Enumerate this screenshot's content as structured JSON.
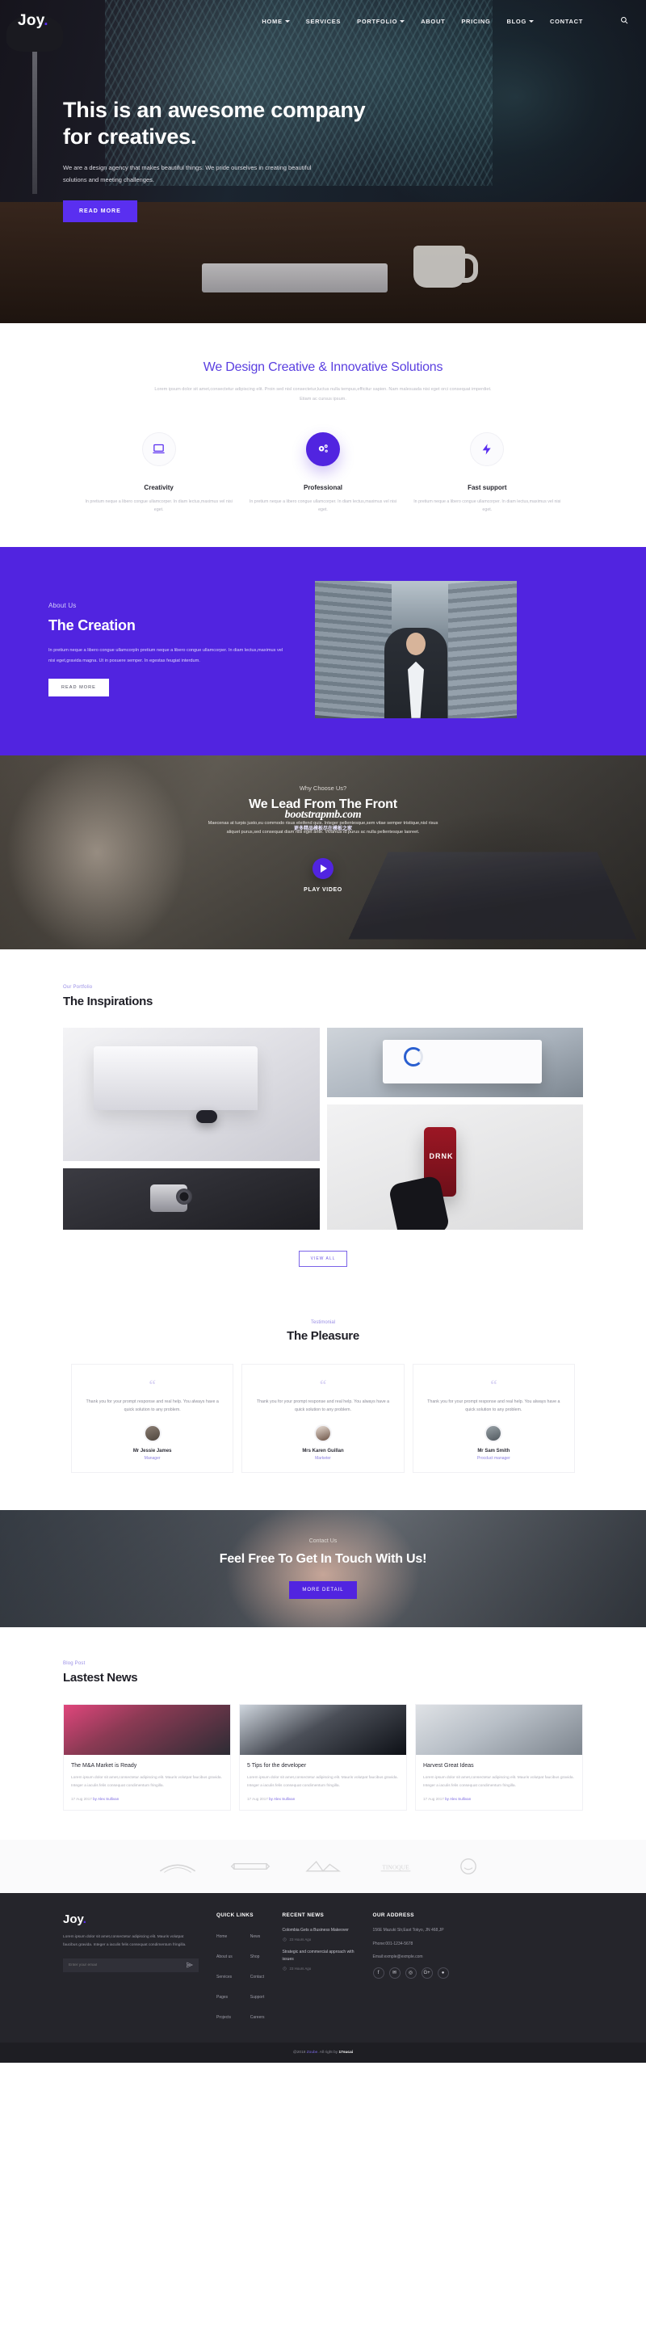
{
  "brand": {
    "name": "Joy",
    "dot": "."
  },
  "nav": {
    "items": [
      {
        "label": "HOME",
        "caret": true
      },
      {
        "label": "SERVICES",
        "caret": false
      },
      {
        "label": "PORTFOLIO",
        "caret": true
      },
      {
        "label": "ABOUT",
        "caret": false
      },
      {
        "label": "PRICING",
        "caret": false
      },
      {
        "label": "BLOG",
        "caret": true
      },
      {
        "label": "CONTACT",
        "caret": false
      }
    ],
    "search_icon": "search-icon"
  },
  "hero": {
    "title_line1": "This is an awesome company",
    "title_line2": "for creatives.",
    "subtitle": "We are a design agency that makes beautiful things. We pride ourselves in creating beautiful solutions and meeting challenges.",
    "cta": "READ MORE"
  },
  "services": {
    "title": "We Design Creative & Innovative Solutions",
    "lead": "Lorem ipsum dolor sit amet,consectetur adipiscing elit. Proin sed nisl consectetur,luctus nulla tempus,efficitur sapien. Nam malesuada nisi eget orci consequat imperdiet. Etiam ac cursus ipsum.",
    "features": [
      {
        "icon": "laptop-icon",
        "title": "Creativity",
        "text": "In pretium neque a libero congue ullamcorper. In diam lectus,maximus vel nisi eget.",
        "active": false
      },
      {
        "icon": "gears-icon",
        "title": "Professional",
        "text": "In pretium neque a libero congue ullamcorper. In diam lectus,maximus vel nisi eget.",
        "active": true
      },
      {
        "icon": "bolt-icon",
        "title": "Fast support",
        "text": "In pretium neque a libero congue ullamcorper. In diam lectus,maximus vel nisi eget.",
        "active": false
      }
    ]
  },
  "about": {
    "eyebrow": "About Us",
    "title": "The Creation",
    "text": "In pretium neque a libero congue ullamcorpIn pretium neque a libero congue ullamcorper. In diam lectus,maximus vel nisi eget,gravida magna. Ut in posuere semper. In egestas feugiat interdum.",
    "cta": "READ MORE"
  },
  "video": {
    "eyebrow": "Why Choose Us?",
    "title": "We Lead From The Front",
    "watermark": "bootstrapmb.com",
    "watermark_cn": "更多精品模板尽在模板之家",
    "text": "Maecenas at turpis justo,eu commodo risus eleifend quis. Integer pellentesque,sem vitae semper tristique,nisl risus aliquet purus,sed consequat diam nisl eget ante. Vivamus id purus ac nulla pellentesque laoreet.",
    "play_label": "PLAY VIDEO",
    "play_icon": "play-icon"
  },
  "portfolio": {
    "eyebrow": "Our Portfolio",
    "title": "The Inspirations",
    "tiles": [
      {
        "name": "imac-and-mouse"
      },
      {
        "name": "laptop-dashboard"
      },
      {
        "name": "drink-bottle",
        "label": "DRNK"
      },
      {
        "name": "vintage-camera"
      }
    ],
    "view_all": "VIEW ALL"
  },
  "testimonial": {
    "eyebrow": "Testimonial",
    "title": "The Pleasure",
    "cards": [
      {
        "text": "Thank you for your prompt response and real help. You always have a quick solution to any problem.",
        "name": "Mr Jessie James",
        "role": "Manager"
      },
      {
        "text": "Thank you for your prompt response and real help. You always have a quick solution to any problem.",
        "name": "Mrs Karen Guillan",
        "role": "Marketer"
      },
      {
        "text": "Thank you for your prompt response and real help. You always have a quick solution to any problem.",
        "name": "Mr Sam Smith",
        "role": "Procduct manager"
      }
    ]
  },
  "cta": {
    "eyebrow": "Contact Us",
    "title": "Feel Free To Get In Touch With Us!",
    "button": "MORE DETAIL"
  },
  "blog": {
    "eyebrow": "Blog Post",
    "title": "Lastest News",
    "posts": [
      {
        "title": "The M&A Market is Ready",
        "text": "Lorem ipsum dolor sit amet,consectetur adipiscing elit. Mauris volutpat faucibus gravida. Integer a iaculis felis consequat condimentum fringilla.",
        "date": "17 Aug 2017",
        "by": "by Alex Sullivan"
      },
      {
        "title": "5 Tips for the developer",
        "text": "Lorem ipsum dolor sit amet,consectetur adipiscing elit. Mauris volutpat faucibus gravida. Integer a iaculis felis consequat condimentum fringilla.",
        "date": "17 Aug 2017",
        "by": "by Alex Sullivan"
      },
      {
        "title": "Harvest Great Ideas",
        "text": "Lorem ipsum dolor sit amet,consectetur adipiscing elit. Mauris volutpat faucibus gravida. Integer a iaculis felis consequat condimentum fringilla.",
        "date": "17 Aug 2017",
        "by": "by Alex Sullivan"
      }
    ]
  },
  "clients": {
    "logos": [
      "client-logo-1",
      "client-logo-2",
      "client-logo-3",
      "client-logo-4",
      "client-logo-5"
    ]
  },
  "footer": {
    "brand": "Joy",
    "about": "Lorem ipsum dolor sit amet,consectetur adipiscing elit. Mauris volutpat faucibus gravida. Integer a iaculis felis consequat condimentum fringilla.",
    "newsletter_placeholder": "Enter your email",
    "send_icon": "send-icon",
    "quick_links": {
      "heading": "QUICK LINKS",
      "col1": [
        "Home",
        "About us",
        "Services",
        "Pages",
        "Projects"
      ],
      "col2": [
        "News",
        "Shop",
        "Contact",
        "Support",
        "Careers"
      ]
    },
    "recent_news": {
      "heading": "RECENT NEWS",
      "items": [
        {
          "title": "Colombia Gets a Business Makeover",
          "time": "23 Hours Ago"
        },
        {
          "title": "Strategic and commercial approach with issues",
          "time": "23 Hours Ago"
        }
      ]
    },
    "address": {
      "heading": "OUR ADDRESS",
      "line": "156E Mazuki Str,East Tokyo, JN 468,JP",
      "phone": "Phone:001-1234-5678",
      "email": "Email:exmple@exmple.com"
    },
    "socials": [
      {
        "name": "facebook-icon",
        "glyph": "f"
      },
      {
        "name": "twitter-icon",
        "glyph": "✉"
      },
      {
        "name": "instagram-icon",
        "glyph": "◎"
      },
      {
        "name": "google-plus-icon",
        "glyph": "G+"
      },
      {
        "name": "github-icon",
        "glyph": "●"
      }
    ],
    "copyright_pre": "@2018 ",
    "copyright_link": "Zoube",
    "copyright_mid": ". All right by ",
    "copyright_strong": "17sucai"
  },
  "colors": {
    "accent": "#5124e0",
    "accent_light": "#7a68e0",
    "dark": "#25252b"
  }
}
